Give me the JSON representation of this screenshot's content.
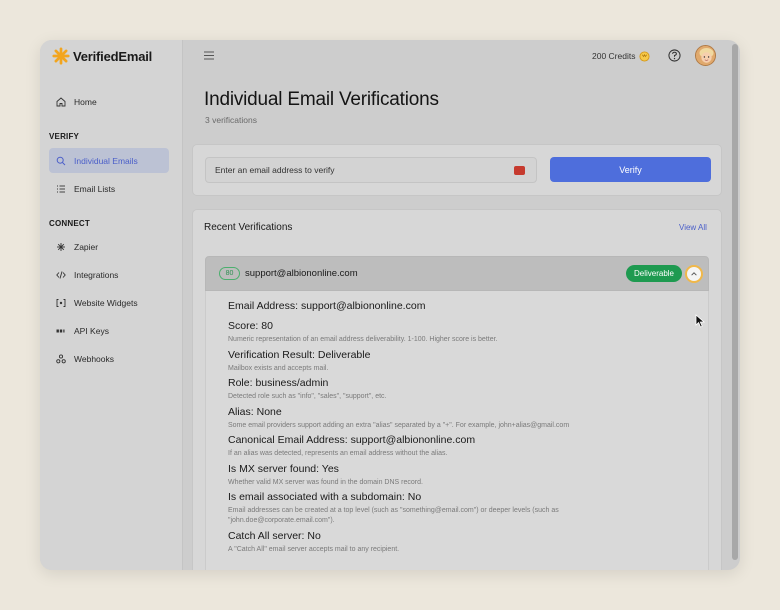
{
  "app": {
    "name": "VerifiedEmail"
  },
  "sidebar": {
    "home": "Home",
    "sections": {
      "verify": "VERIFY",
      "connect": "CONNECT"
    },
    "verify_items": [
      {
        "label": "Individual Emails",
        "icon": "search-icon",
        "active": true
      },
      {
        "label": "Email Lists",
        "icon": "list-icon"
      }
    ],
    "connect_items": [
      {
        "label": "Zapier",
        "icon": "asterisk-icon"
      },
      {
        "label": "Integrations",
        "icon": "code-icon"
      },
      {
        "label": "Website Widgets",
        "icon": "widget-icon"
      },
      {
        "label": "API Keys",
        "icon": "api-icon"
      },
      {
        "label": "Webhooks",
        "icon": "webhook-icon"
      }
    ]
  },
  "topbar": {
    "credits": "200 Credits"
  },
  "page": {
    "title": "Individual Email Verifications",
    "subtitle": "3 verifications"
  },
  "form": {
    "input_value": "Enter an email address to verify",
    "verify_label": "Verify"
  },
  "recent": {
    "title": "Recent Verifications",
    "view_all": "View All",
    "item": {
      "score": "80",
      "email": "support@albiononline.com",
      "status": "Deliverable"
    },
    "details": [
      {
        "label": "Email Address:",
        "value": "support@albiononline.com",
        "desc": ""
      },
      {
        "label": "Score:",
        "value": "80",
        "desc": "Numeric representation of an email address deliverability. 1-100. Higher score is better."
      },
      {
        "label": "Verification Result:",
        "value": "Deliverable",
        "desc": "Mailbox exists and accepts mail."
      },
      {
        "label": "Role:",
        "value": "business/admin",
        "desc": "Detected role such as \"info\", \"sales\", \"support\", etc."
      },
      {
        "label": "Alias:",
        "value": "None",
        "desc": "Some email providers support adding an extra \"alias\" separated by a \"+\". For example, john+alias@gmail.com"
      },
      {
        "label": "Canonical Email Address:",
        "value": "support@albiononline.com",
        "desc": "If an alias was detected, represents an email address without the alias."
      },
      {
        "label": "Is MX server found:",
        "value": "Yes",
        "desc": "Whether valid MX server was found in the domain DNS record."
      },
      {
        "label": "Is email associated with a subdomain:",
        "value": "No",
        "desc": "Email addresses can be created at a top level (such as \"something@email.com\") or deeper levels (such as \"john.doe@corporate.email.com\")."
      },
      {
        "label": "Catch All server:",
        "value": "No",
        "desc": "A \"Catch All\" email server accepts mail to any recipient."
      }
    ]
  },
  "colors": {
    "accent": "#4e6edc",
    "success": "#1e9a50",
    "logo": "#f2a51f"
  }
}
